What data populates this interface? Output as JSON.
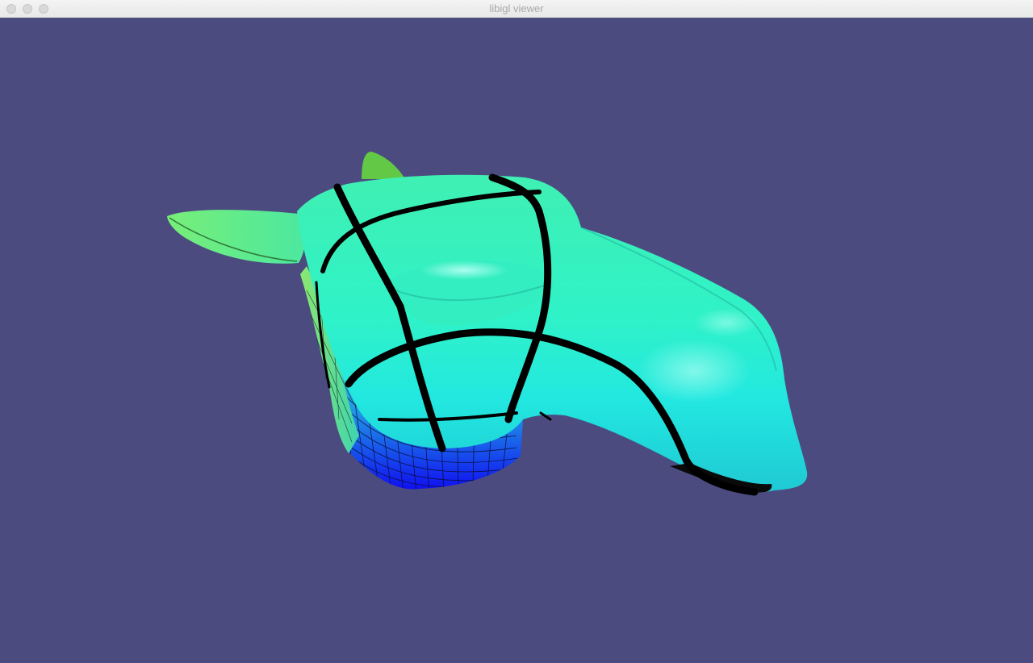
{
  "window": {
    "title": "libigl viewer",
    "controls": [
      {
        "name": "close-button",
        "icon": "circle"
      },
      {
        "name": "minimize-button",
        "icon": "circle"
      },
      {
        "name": "zoom-button",
        "icon": "circle"
      }
    ]
  },
  "viewport": {
    "background_color": "#4b4b80",
    "mesh": {
      "subject": "camel-head",
      "colormap": [
        "#0a1af0",
        "#22b8d8",
        "#32f0c8",
        "#5ef090",
        "#72d850"
      ],
      "isoline_color": "#000000",
      "shading": "smooth"
    }
  }
}
